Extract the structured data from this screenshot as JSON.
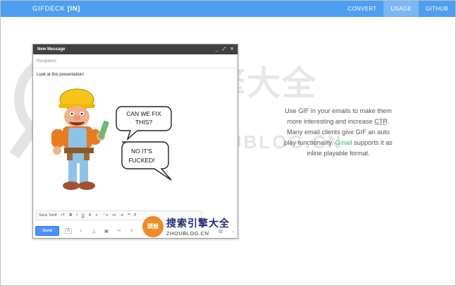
{
  "nav": {
    "brand_name": "GIFDECK",
    "brand_suffix": "[IN]",
    "links": [
      "CONVERT",
      "USAGE",
      "GITHUB"
    ],
    "active": "USAGE",
    "colors": {
      "bar": "#4e9ef2",
      "active": "#7bb6f5"
    }
  },
  "compose": {
    "title": "New Message",
    "controls": [
      "_",
      "⤢",
      "✕"
    ],
    "recipients_placeholder": "Recipients",
    "body": "Look at this presentation!",
    "bubble1": [
      "CAN WE FIX",
      "THIS?"
    ],
    "bubble2": [
      "NO IT'S",
      "FUCKED!"
    ],
    "format_bar": {
      "font": "Sans Serif",
      "size": "тT",
      "bold": "B",
      "italic": "I",
      "underline": "U",
      "text_color": "A"
    },
    "send_label": "Send",
    "icons": [
      "text-format-icon",
      "attach-icon",
      "drive-icon",
      "photo-icon",
      "link-icon",
      "emoji-icon",
      "trash-icon",
      "more-options-icon"
    ]
  },
  "description": {
    "line1": "Use GIF in your emails to make them",
    "line2_a": "more interesting and increase ",
    "line2_abbr": "CTR",
    "line2_b": ".",
    "line3": "Many email clients give GIF an auto",
    "line4_a": "play functionality. ",
    "line4_gmail": "Gmail",
    "line4_b": " supports it as",
    "line5": "inline playable format."
  },
  "watermark": {
    "cn": "搜索引擎大全",
    "en": "ZHOUBLOG.CN",
    "badge": "頭條"
  }
}
